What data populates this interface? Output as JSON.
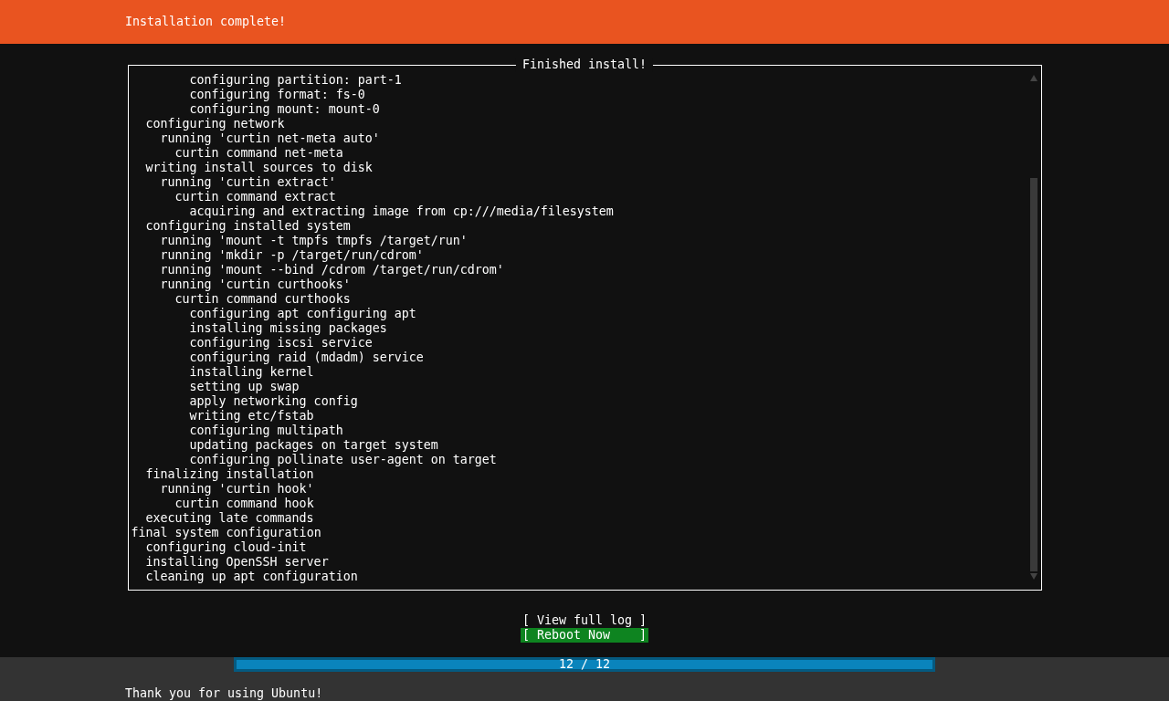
{
  "header": {
    "title": "Installation complete!"
  },
  "log_panel": {
    "title": "Finished install!",
    "lines": [
      {
        "children": [
          {
            "children": [
              {
                "children": [
                  {
                    "children": [
                      {
                        "text": "configuring partition: part-1"
                      },
                      {
                        "text": "configuring format: fs-0"
                      },
                      {
                        "text": "configuring mount: mount-0"
                      }
                    ]
                  }
                ]
              }
            ]
          },
          {
            "text": "configuring network",
            "children": [
              {
                "text": "running 'curtin net-meta auto'",
                "children": [
                  {
                    "text": "curtin command net-meta"
                  }
                ]
              }
            ]
          },
          {
            "text": "writing install sources to disk",
            "children": [
              {
                "text": "running 'curtin extract'",
                "children": [
                  {
                    "text": "curtin command extract",
                    "children": [
                      {
                        "text": "acquiring and extracting image from cp:///media/filesystem"
                      }
                    ]
                  }
                ]
              }
            ]
          },
          {
            "text": "configuring installed system",
            "children": [
              {
                "text": "running 'mount -t tmpfs tmpfs /target/run'"
              },
              {
                "text": "running 'mkdir -p /target/run/cdrom'"
              },
              {
                "text": "running 'mount --bind /cdrom /target/run/cdrom'"
              },
              {
                "text": "running 'curtin curthooks'",
                "children": [
                  {
                    "text": "curtin command curthooks",
                    "children": [
                      {
                        "text": "configuring apt configuring apt"
                      },
                      {
                        "text": "installing missing packages"
                      },
                      {
                        "text": "configuring iscsi service"
                      },
                      {
                        "text": "configuring raid (mdadm) service"
                      },
                      {
                        "text": "installing kernel"
                      },
                      {
                        "text": "setting up swap"
                      },
                      {
                        "text": "apply networking config"
                      },
                      {
                        "text": "writing etc/fstab"
                      },
                      {
                        "text": "configuring multipath"
                      },
                      {
                        "text": "updating packages on target system"
                      },
                      {
                        "text": "configuring pollinate user-agent on target"
                      }
                    ]
                  }
                ]
              }
            ]
          },
          {
            "text": "finalizing installation",
            "children": [
              {
                "text": "running 'curtin hook'",
                "children": [
                  {
                    "text": "curtin command hook"
                  }
                ]
              }
            ]
          },
          {
            "text": "executing late commands"
          }
        ]
      },
      {
        "text": "final system configuration",
        "children": [
          {
            "text": "configuring cloud-init"
          },
          {
            "text": "installing OpenSSH server"
          },
          {
            "text": "cleaning up apt configuration"
          }
        ]
      }
    ]
  },
  "buttons": [
    {
      "label": "[ View full log ]",
      "selected": false
    },
    {
      "label": "[ Reboot Now    ]",
      "selected": true
    }
  ],
  "progress": {
    "label": "12 / 12",
    "level": 1
  },
  "footer": {
    "message": "Thank you for using Ubuntu!"
  }
}
